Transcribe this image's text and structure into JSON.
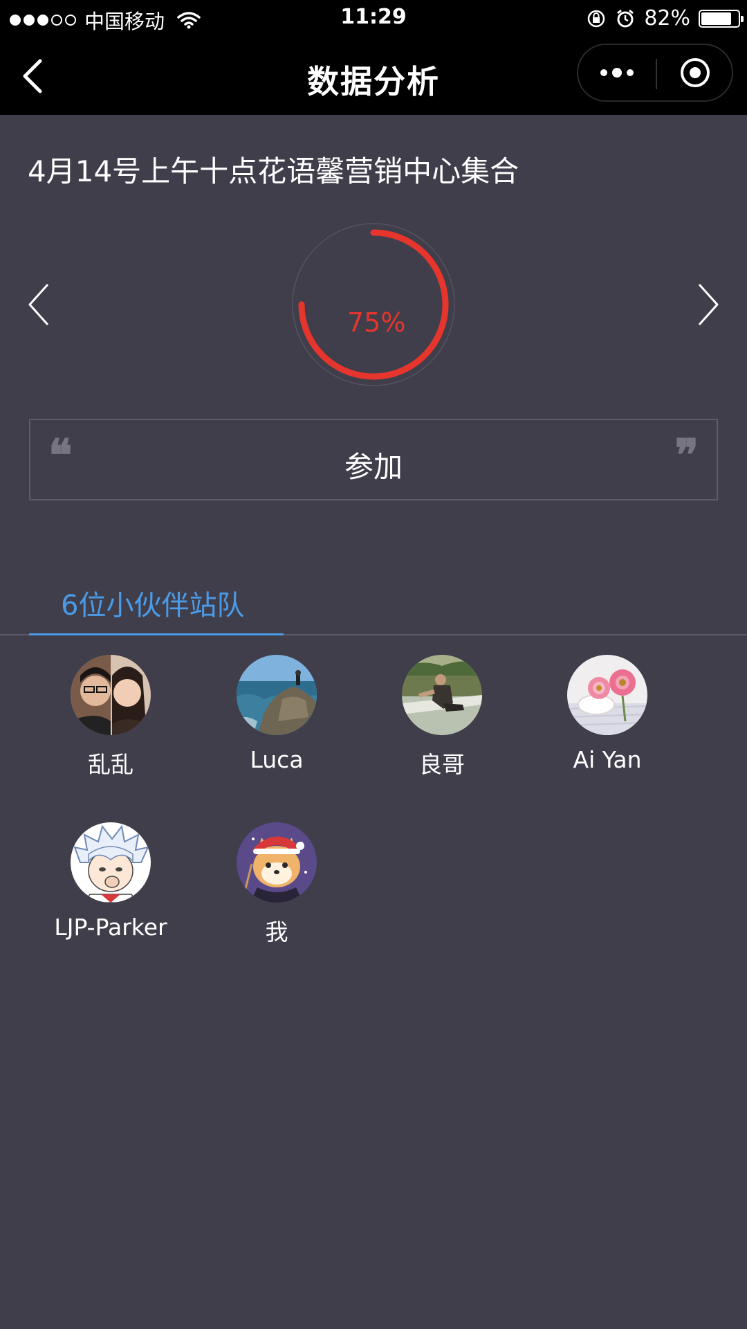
{
  "status_bar": {
    "carrier": "中国移动",
    "time": "11:29",
    "battery": "82%",
    "battery_level": 0.82,
    "signal_bars": 3,
    "signal_total": 5
  },
  "nav": {
    "title": "数据分析",
    "back_icon": "chevron-left-icon",
    "more_icon": "more-dots-icon",
    "close_icon": "target-close-icon"
  },
  "event": {
    "title": "4月14号上午十点花语馨营销中心集合",
    "progress_label": "75%",
    "progress_value": 0.75,
    "progress_color": "#e5352c"
  },
  "answer": {
    "quote_open": "❝",
    "text": "参加",
    "quote_close": "❞"
  },
  "tab": {
    "label": "6位小伙伴站队",
    "color": "#4a9be8"
  },
  "members": [
    {
      "name": "乱乱"
    },
    {
      "name": "Luca"
    },
    {
      "name": "良哥"
    },
    {
      "name": "Ai Yan"
    },
    {
      "name": "LJP-Parker"
    },
    {
      "name": "我"
    }
  ]
}
